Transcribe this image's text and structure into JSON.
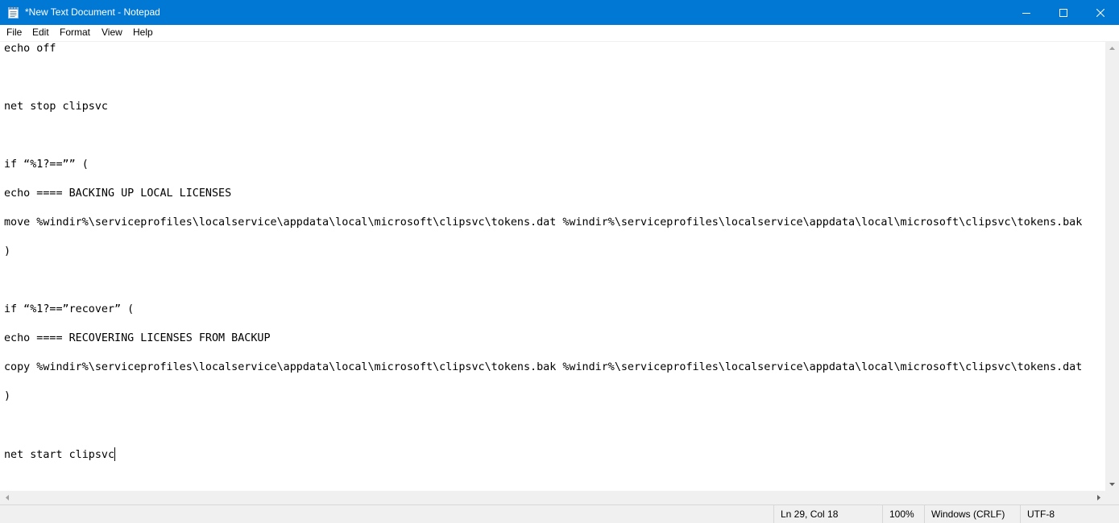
{
  "window": {
    "title": "*New Text Document - Notepad",
    "accent_color": "#0078d4",
    "app_icon": "notepad-icon",
    "controls": {
      "minimize_icon": "minimize-icon",
      "maximize_icon": "maximize-icon",
      "close_icon": "close-icon"
    }
  },
  "menu": {
    "file": "File",
    "edit": "Edit",
    "format": "Format",
    "view": "View",
    "help": "Help"
  },
  "editor": {
    "lines": [
      "echo off",
      "",
      "",
      "",
      "net stop clipsvc",
      "",
      "",
      "",
      "if “%1?==”” (",
      "",
      "echo ==== BACKING UP LOCAL LICENSES",
      "",
      "move %windir%\\serviceprofiles\\localservice\\appdata\\local\\microsoft\\clipsvc\\tokens.dat %windir%\\serviceprofiles\\localservice\\appdata\\local\\microsoft\\clipsvc\\tokens.bak",
      "",
      ")",
      "",
      "",
      "",
      "if “%1?==”recover” (",
      "",
      "echo ==== RECOVERING LICENSES FROM BACKUP",
      "",
      "copy %windir%\\serviceprofiles\\localservice\\appdata\\local\\microsoft\\clipsvc\\tokens.bak %windir%\\serviceprofiles\\localservice\\appdata\\local\\microsoft\\clipsvc\\tokens.dat",
      "",
      ")",
      "",
      "",
      "",
      "net start clipsvc"
    ]
  },
  "status": {
    "position": "Ln 29, Col 18",
    "zoom": "100%",
    "line_ending": "Windows (CRLF)",
    "encoding": "UTF-8"
  }
}
